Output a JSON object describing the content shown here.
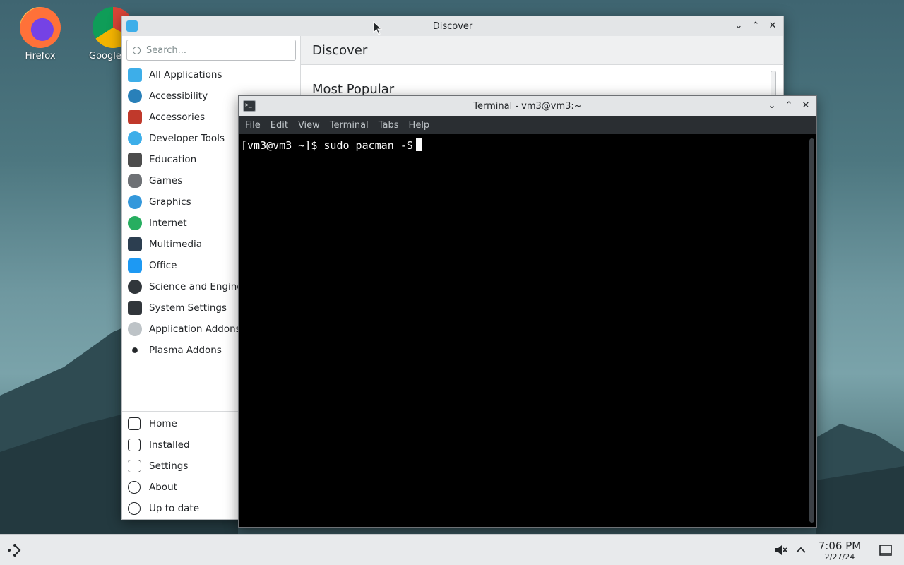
{
  "desktop": {
    "icons": [
      {
        "label": "Firefox"
      },
      {
        "label": "Google"
      }
    ]
  },
  "discover": {
    "title": "Discover",
    "search_placeholder": "Search...",
    "header": "Discover",
    "section_title": "Most Popular",
    "categories": [
      {
        "label": "All Applications",
        "icon": "grid-icon",
        "color": "#3daee9"
      },
      {
        "label": "Accessibility",
        "icon": "accessibility-icon",
        "color": "#2980b9"
      },
      {
        "label": "Accessories",
        "icon": "toolbox-icon",
        "color": "#c0392b"
      },
      {
        "label": "Developer Tools",
        "icon": "hammer-icon",
        "color": "#3daee9"
      },
      {
        "label": "Education",
        "icon": "chalkboard-icon",
        "color": "#4d4d4d"
      },
      {
        "label": "Games",
        "icon": "gamepad-icon",
        "color": "#6e7175"
      },
      {
        "label": "Graphics",
        "icon": "graphics-icon",
        "color": "#3498db"
      },
      {
        "label": "Internet",
        "icon": "globe-icon",
        "color": "#27ae60"
      },
      {
        "label": "Multimedia",
        "icon": "multimedia-icon",
        "color": "#2c3e50"
      },
      {
        "label": "Office",
        "icon": "office-icon",
        "color": "#1d99f3"
      },
      {
        "label": "Science and Engineering",
        "icon": "flask-icon",
        "color": "#31363b"
      },
      {
        "label": "System Settings",
        "icon": "system-settings-icon",
        "color": "#31363b"
      },
      {
        "label": "Application Addons",
        "icon": "addons-icon",
        "color": "#bdc3c7"
      },
      {
        "label": "Plasma Addons",
        "icon": "plasma-icon",
        "color": "#232629"
      }
    ],
    "nav": [
      {
        "label": "Home",
        "icon": "home-icon"
      },
      {
        "label": "Installed",
        "icon": "installed-icon"
      },
      {
        "label": "Settings",
        "icon": "settings-icon"
      },
      {
        "label": "About",
        "icon": "info-icon"
      },
      {
        "label": "Up to date",
        "icon": "update-icon"
      }
    ]
  },
  "terminal": {
    "title": "Terminal - vm3@vm3:~",
    "menu": [
      "File",
      "Edit",
      "View",
      "Terminal",
      "Tabs",
      "Help"
    ],
    "prompt": "[vm3@vm3 ~]$ ",
    "command": "sudo pacman -S"
  },
  "taskbar": {
    "time": "7:06 PM",
    "date": "2/27/24"
  }
}
